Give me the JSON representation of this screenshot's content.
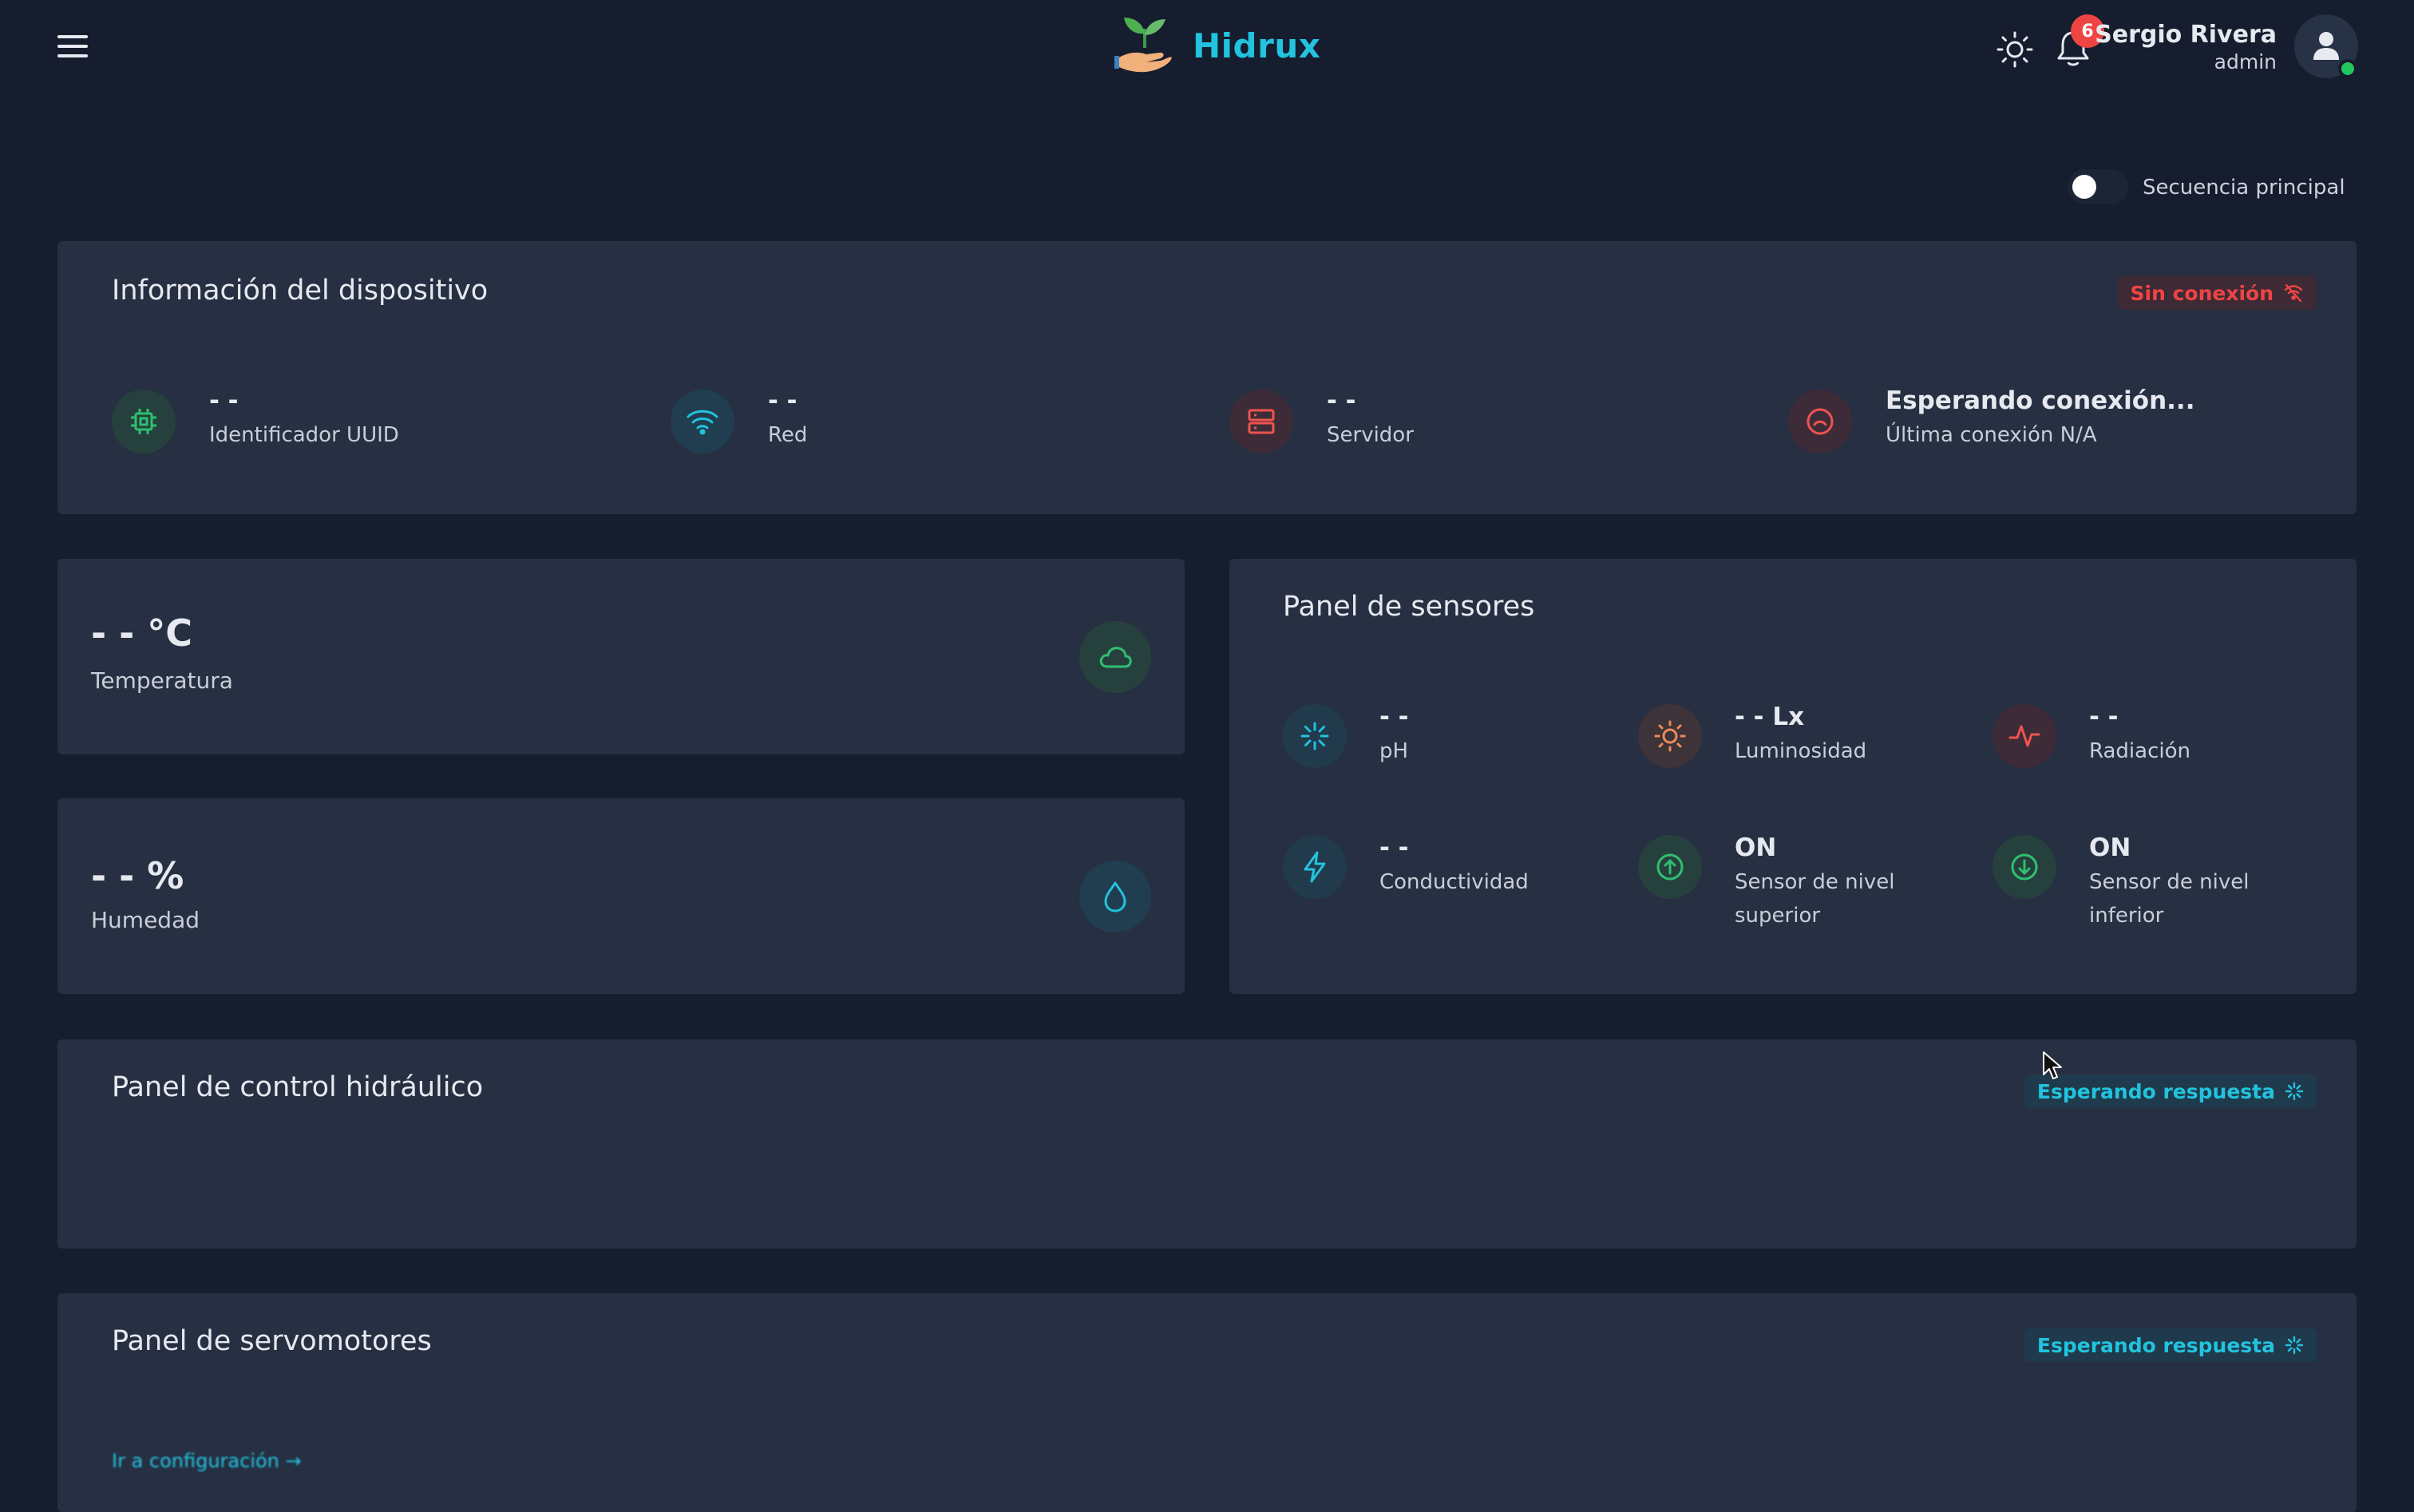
{
  "header": {
    "brand": "Hidrux",
    "notification_count": "6",
    "user_name": "Sergio Rivera",
    "user_role": "admin"
  },
  "sequence_toggle": {
    "label": "Secuencia principal",
    "on": false
  },
  "device_info": {
    "title": "Información del dispositivo",
    "status_badge": "Sin conexión",
    "items": [
      {
        "value": "- -",
        "label": "Identificador UUID",
        "icon": "chip-icon"
      },
      {
        "value": "- -",
        "label": "Red",
        "icon": "wifi-icon"
      },
      {
        "value": "- -",
        "label": "Servidor",
        "icon": "server-icon"
      },
      {
        "value": "Esperando conexión...",
        "label": "Última conexión N/A",
        "icon": "disconnected-icon"
      }
    ]
  },
  "temperature": {
    "value": "- - °C",
    "label": "Temperatura",
    "icon": "cloud-icon"
  },
  "humidity": {
    "value": "- - %",
    "label": "Humedad",
    "icon": "droplet-icon"
  },
  "sensors": {
    "title": "Panel de sensores",
    "items": [
      {
        "value": "- -",
        "label": "pH",
        "icon": "loader-icon"
      },
      {
        "value": "- - Lx",
        "label": "Luminosidad",
        "icon": "sun-icon"
      },
      {
        "value": "- -",
        "label": "Radiación",
        "icon": "activity-icon"
      },
      {
        "value": "- -",
        "label": "Conductividad",
        "icon": "bolt-icon"
      },
      {
        "value": "ON",
        "label_line1": "Sensor de nivel",
        "label_line2": "superior",
        "icon": "arrow-up-circle-icon"
      },
      {
        "value": "ON",
        "label_line1": "Sensor de nivel",
        "label_line2": "inferior",
        "icon": "arrow-down-circle-icon"
      }
    ]
  },
  "hydraulic": {
    "title": "Panel de control hidráulico",
    "status_badge": "Esperando respuesta"
  },
  "servos": {
    "title": "Panel de servomotores",
    "status_badge": "Esperando respuesta",
    "config_link": "Ir a configuración →"
  },
  "colors": {
    "background": "#151d2e",
    "card": "#272f42",
    "accent_cyan": "#22c3de",
    "green": "#22c55e",
    "red": "#ef4444",
    "orange": "#f08a5d"
  }
}
